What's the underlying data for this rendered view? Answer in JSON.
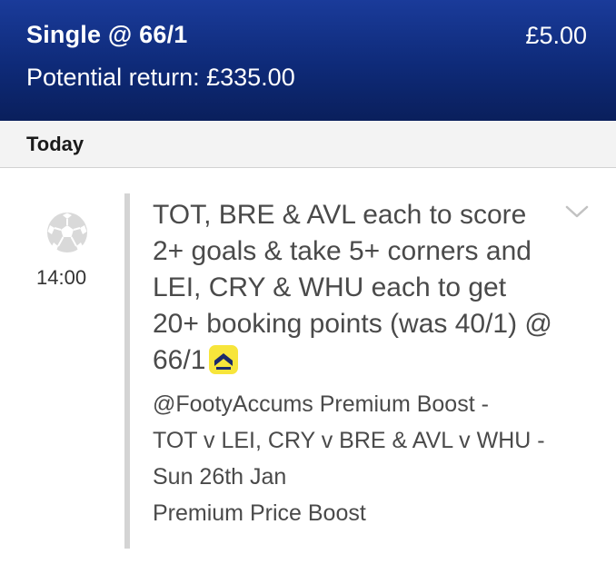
{
  "header": {
    "bet_title": "Single @ 66/1",
    "stake": "£5.00",
    "potential_return": "Potential return: £335.00"
  },
  "day": {
    "label": "Today"
  },
  "leg": {
    "sport_icon": "football-icon",
    "kickoff": "14:00",
    "selection": "TOT, BRE & AVL each to score 2+ goals & take 5+ corners and LEI, CRY & WHU each to get 20+ booking points (was 40/1) @ 66/1",
    "boost_badge_icon": "price-boost-icon",
    "market_lines": [
      "@FootyAccums Premium Boost -",
      "TOT v LEI, CRY v BRE & AVL v WHU -",
      "Sun 26th Jan"
    ],
    "boost_type": "Premium Price Boost",
    "expand_icon": "chevron-down-icon"
  },
  "colors": {
    "header_bg": "#0e2a78",
    "boost_badge_bg": "#f7e53b",
    "boost_badge_fg": "#1b2a6b",
    "divider": "#d4d4d4"
  }
}
